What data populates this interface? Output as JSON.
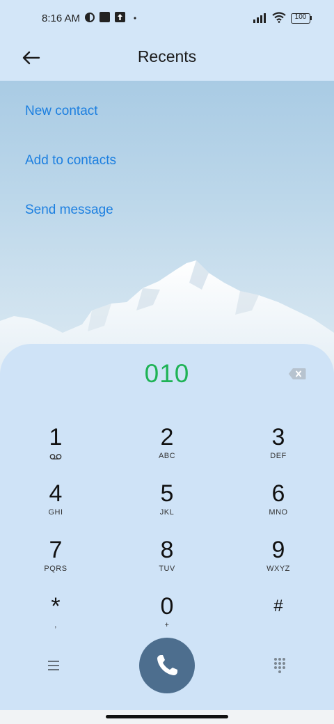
{
  "status_bar": {
    "time": "8:16 AM",
    "battery": "100",
    "icons": [
      "notification-app-icon",
      "square-notification-icon",
      "upload-notification-icon",
      "dot-icon",
      "signal-icon",
      "wifi-icon",
      "battery-icon"
    ]
  },
  "header": {
    "title": "Recents",
    "back_icon": "arrow-left-icon"
  },
  "actions": [
    {
      "label": "New contact"
    },
    {
      "label": "Add to contacts"
    },
    {
      "label": "Send message"
    }
  ],
  "dialer": {
    "number": "010",
    "number_color": "#1fb356",
    "keys": [
      {
        "digit": "1",
        "letters": ""
      },
      {
        "digit": "2",
        "letters": "ABC"
      },
      {
        "digit": "3",
        "letters": "DEF"
      },
      {
        "digit": "4",
        "letters": "GHI"
      },
      {
        "digit": "5",
        "letters": "JKL"
      },
      {
        "digit": "6",
        "letters": "MNO"
      },
      {
        "digit": "7",
        "letters": "PQRS"
      },
      {
        "digit": "8",
        "letters": "TUV"
      },
      {
        "digit": "9",
        "letters": "WXYZ"
      },
      {
        "digit": "*",
        "letters": ","
      },
      {
        "digit": "0",
        "letters": "+"
      },
      {
        "digit": "#",
        "letters": ""
      }
    ],
    "call_button_color": "#4d6e8e",
    "link_color": "#1c7fe0"
  }
}
